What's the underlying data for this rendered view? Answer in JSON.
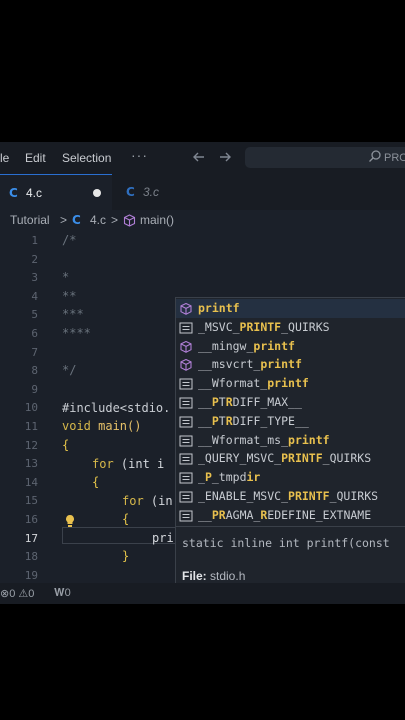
{
  "menu": {
    "items": [
      "le",
      "Edit",
      "Selection"
    ],
    "more": "···",
    "back_icon": "arrow-left-icon",
    "forward_icon": "arrow-right-icon",
    "search_label": "PRO"
  },
  "tabs": [
    {
      "label": "4.c",
      "icon": "C",
      "modified": true
    },
    {
      "label": "3.c",
      "icon": "C"
    }
  ],
  "breadcrumb": {
    "folder": "Tutorial",
    "sep": ">",
    "file_icon": "C",
    "file": "4.c",
    "symbol": "main()"
  },
  "gutter": [
    "1",
    "2",
    "3",
    "4",
    "5",
    "6",
    "7",
    "8",
    "9",
    "10",
    "11",
    "12",
    "13",
    "14",
    "15",
    "16",
    "17",
    "18",
    "19"
  ],
  "current_line": "17",
  "code": {
    "l1": "/*",
    "l4": "*",
    "l5": "**",
    "l6": "***",
    "l7": "****",
    "l9": "*/",
    "l11": "#include<stdio.",
    "l12_kw": "void",
    "l12_fn": " main()",
    "l13": "{",
    "l14_kw": "for",
    "l14_rest": " (int i",
    "l15": "{",
    "l16_kw": "for",
    "l16_rest": " (in",
    "l17": "{",
    "l18": "pri",
    "l19": "}"
  },
  "suggestions": [
    {
      "pre": "",
      "m1": "pri",
      "mid": "",
      "m2": "ntf",
      "post": "",
      "icon": "cube-icon",
      "selected": true
    },
    {
      "pre": "_MSVC_",
      "m1": "PRI",
      "mid": "",
      "m2": "NTF",
      "post": "_QUIRKS",
      "icon": "text-icon"
    },
    {
      "pre": "__mingw_",
      "m1": "pri",
      "mid": "",
      "m2": "ntf",
      "post": "",
      "icon": "cube-icon"
    },
    {
      "pre": "__msvcrt_",
      "m1": "pri",
      "mid": "",
      "m2": "ntf",
      "post": "",
      "icon": "cube-icon"
    },
    {
      "pre": "__Wformat_",
      "m1": "pri",
      "mid": "",
      "m2": "ntf",
      "post": "",
      "icon": "text-icon"
    },
    {
      "pre": "__",
      "m1": "P",
      "mid": "T",
      "m2": "R",
      "post": "DIFF_MAX__",
      "icon": "text-icon"
    },
    {
      "pre": "__",
      "m1": "P",
      "mid": "T",
      "m2": "R",
      "post": "DIFF_TYPE__",
      "icon": "text-icon"
    },
    {
      "pre": "__Wformat_ms_",
      "m1": "pri",
      "mid": "",
      "m2": "ntf",
      "post": "",
      "icon": "text-icon"
    },
    {
      "pre": "_QUERY_MSVC_",
      "m1": "PRI",
      "mid": "",
      "m2": "NTF",
      "post": "_QUIRKS",
      "icon": "text-icon"
    },
    {
      "pre": "_",
      "m1": "P",
      "mid": "_tmpd",
      "m2": "ir",
      "post": "",
      "icon": "text-icon"
    },
    {
      "pre": "_ENABLE_MSVC_",
      "m1": "PRI",
      "mid": "",
      "m2": "NTF",
      "post": "_QUIRKS",
      "icon": "text-icon"
    },
    {
      "pre": "__",
      "m1": "PR",
      "mid": "AGMA_",
      "m2": "R",
      "post": "EDEFINE_EXTNAME",
      "icon": "text-icon"
    }
  ],
  "details": {
    "signature": "static inline int printf(const",
    "file_key": "File:",
    "file_value": " stdio.h"
  },
  "status": {
    "errors": "0",
    "warnings": "0",
    "ports": "0"
  },
  "colors": {
    "accent": "#2a6fd1",
    "match": "#e8c04e",
    "keyword": "#d7b84a",
    "comment": "#6a737d"
  }
}
